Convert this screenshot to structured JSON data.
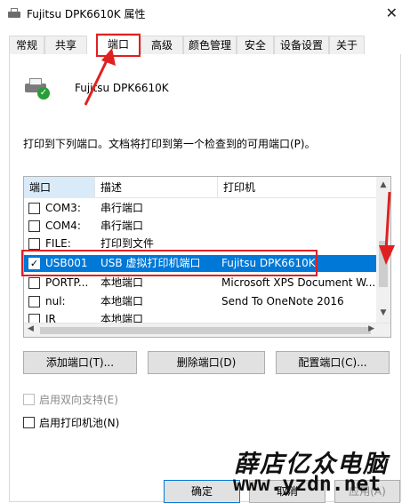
{
  "window": {
    "title": "Fujitsu DPK6610K 属性",
    "close_glyph": "✕"
  },
  "tabs": [
    {
      "label": "常规"
    },
    {
      "label": "共享"
    },
    {
      "label": "端口",
      "active": true
    },
    {
      "label": "高级"
    },
    {
      "label": "颜色管理"
    },
    {
      "label": "安全"
    },
    {
      "label": "设备设置"
    },
    {
      "label": "关于"
    }
  ],
  "printer": {
    "name": "Fujitsu DPK6610K",
    "icon": "printer-ready-icon"
  },
  "instruction": "打印到下列端口。文档将打印到第一个检查到的可用端口(P)。",
  "ports": {
    "columns": [
      "端口",
      "描述",
      "打印机"
    ],
    "rows": [
      {
        "checked": false,
        "port": "COM3:",
        "description": "串行端口",
        "printer": ""
      },
      {
        "checked": false,
        "port": "COM4:",
        "description": "串行端口",
        "printer": ""
      },
      {
        "checked": false,
        "port": "FILE:",
        "description": "打印到文件",
        "printer": ""
      },
      {
        "checked": true,
        "selected": true,
        "port": "USB001",
        "description": "USB 虚拟打印机端口",
        "printer": "Fujitsu DPK6610K"
      },
      {
        "checked": false,
        "port": "PORTP...",
        "description": "本地端口",
        "printer": "Microsoft XPS Document W..."
      },
      {
        "checked": false,
        "port": "nul:",
        "description": "本地端口",
        "printer": "Send To OneNote 2016"
      },
      {
        "checked": false,
        "port": "IR",
        "description": "本地端口",
        "printer": ""
      }
    ]
  },
  "buttons": {
    "add_port": "添加端口(T)...",
    "delete_port": "删除端口(D)",
    "configure_port": "配置端口(C)...",
    "ok": "确定",
    "cancel": "取消",
    "apply": "应用(A)"
  },
  "options": {
    "bidirectional": "启用双向支持(E)",
    "pooling": "启用打印机池(N)"
  },
  "watermark": {
    "chinese": "薛店亿众电脑",
    "url": "www.yzdn.net"
  },
  "colors": {
    "selection": "#0078d7",
    "annotation_red": "#e02020"
  }
}
